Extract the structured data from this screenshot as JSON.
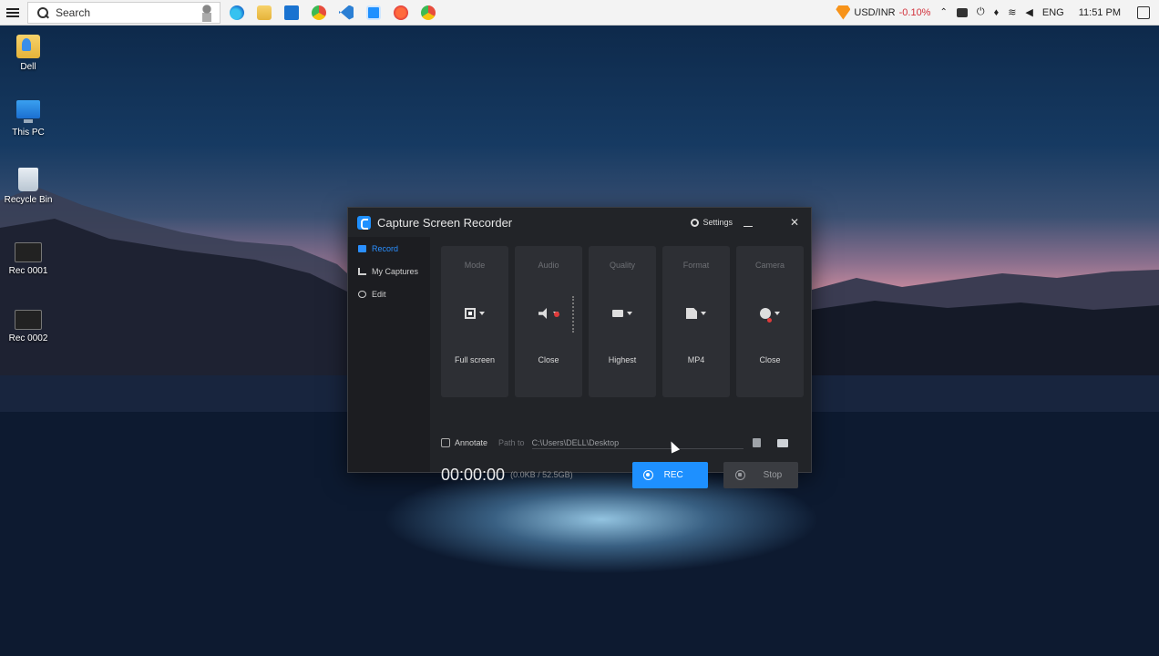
{
  "taskbar": {
    "search_placeholder": "Search",
    "stock_label": "USD/INR",
    "stock_change": "-0.10%",
    "language": "ENG",
    "time": "11:51 PM"
  },
  "desktop_icons": [
    {
      "label": "Dell",
      "icon": "folder-icon"
    },
    {
      "label": "This PC",
      "icon": "computer-icon"
    },
    {
      "label": "Recycle Bin",
      "icon": "recycle-bin-icon"
    },
    {
      "label": "Rec 0001",
      "icon": "video-file-icon"
    },
    {
      "label": "Rec 0002",
      "icon": "video-file-icon"
    }
  ],
  "app": {
    "title": "Capture Screen Recorder",
    "settings_label": "Settings",
    "nav": [
      {
        "label": "Record",
        "active": true
      },
      {
        "label": "My Captures",
        "active": false
      },
      {
        "label": "Edit",
        "active": false
      }
    ],
    "cards": [
      {
        "title": "Mode",
        "value": "Full screen",
        "icon": "fullscreen-icon"
      },
      {
        "title": "Audio",
        "value": "Close",
        "icon": "speaker-icon"
      },
      {
        "title": "Quality",
        "value": "Highest",
        "icon": "monitor-icon"
      },
      {
        "title": "Format",
        "value": "MP4",
        "icon": "file-icon"
      },
      {
        "title": "Camera",
        "value": "Close",
        "icon": "webcam-icon"
      }
    ],
    "annotate_label": "Annotate",
    "path_label": "Path to",
    "path_value": "C:\\Users\\DELL\\Desktop",
    "timer": "00:00:00",
    "size_info": "(0.0KB / 52.5GB)",
    "rec_label": "REC",
    "stop_label": "Stop"
  },
  "colors": {
    "accent": "#1e90ff",
    "window_bg": "#222428",
    "card_bg": "#2d2f34"
  }
}
